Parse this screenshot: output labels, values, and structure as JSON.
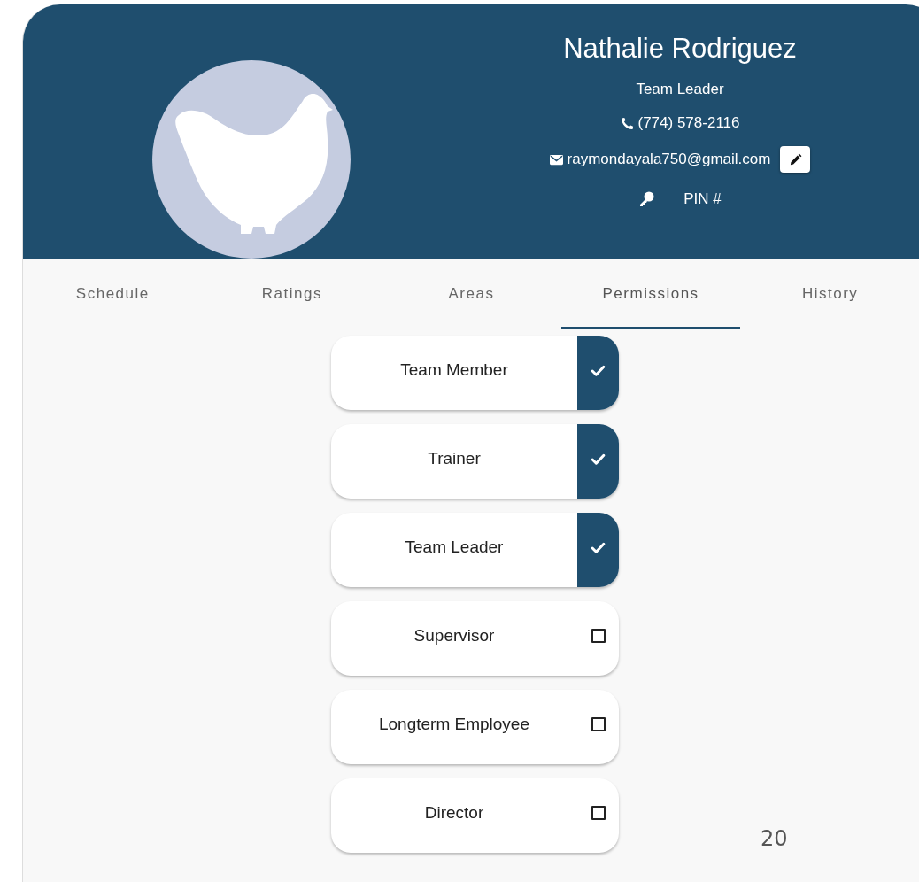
{
  "profile": {
    "name": "Nathalie Rodriguez",
    "role": "Team Leader",
    "phone": "(774) 578-2116",
    "email": "raymondayala750@gmail.com",
    "pin_label": "PIN #"
  },
  "tabs": [
    {
      "label": "Schedule",
      "selected": false
    },
    {
      "label": "Ratings",
      "selected": false
    },
    {
      "label": "Areas",
      "selected": false
    },
    {
      "label": "Permissions",
      "selected": true
    },
    {
      "label": "History",
      "selected": false
    }
  ],
  "permissions": [
    {
      "label": "Team Member",
      "checked": true
    },
    {
      "label": "Trainer",
      "checked": true
    },
    {
      "label": "Team Leader",
      "checked": true
    },
    {
      "label": "Supervisor",
      "checked": false
    },
    {
      "label": "Longterm Employee",
      "checked": false
    },
    {
      "label": "Director",
      "checked": false
    }
  ],
  "page_number": "20"
}
